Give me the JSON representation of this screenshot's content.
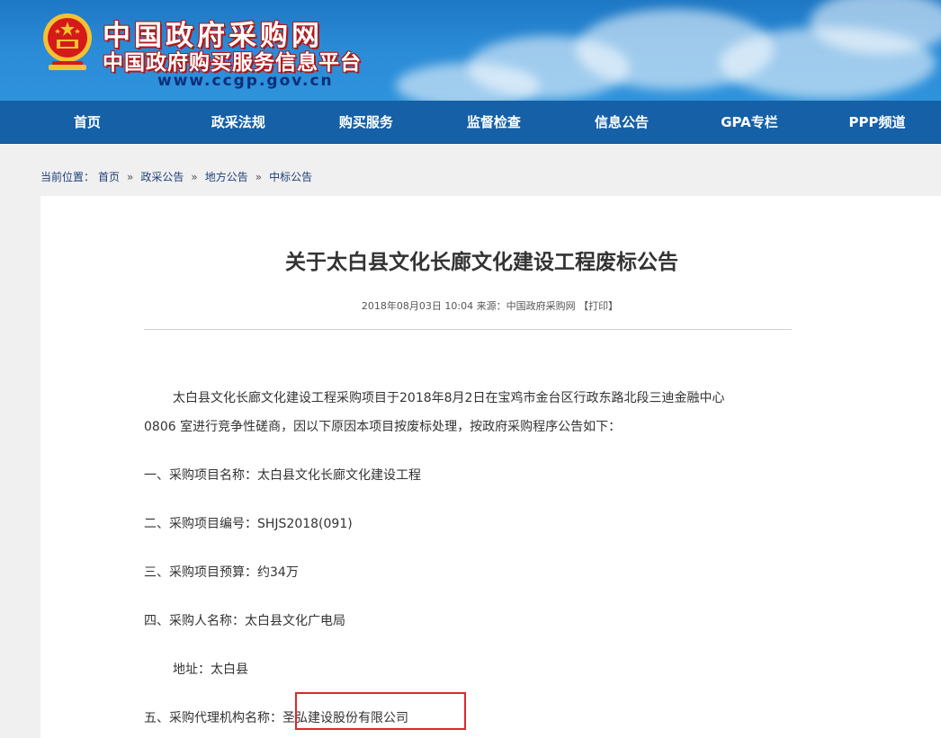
{
  "header": {
    "title": "中国政府采购网",
    "subtitle": "中国政府购买服务信息平台",
    "url": "www.ccgp.gov.cn",
    "emblem_icon": "national-emblem-icon",
    "emblem_color": "#d51a1a",
    "banner_color": "#2a8ad6"
  },
  "nav": {
    "items": [
      "首页",
      "政采法规",
      "购买服务",
      "监督检查",
      "信息公告",
      "GPA专栏",
      "PPP频道"
    ],
    "color": "#1560a6"
  },
  "breadcrumb": {
    "label": "当前位置：",
    "items": [
      "首页",
      "政采公告",
      "地方公告",
      "中标公告"
    ],
    "separator": "»"
  },
  "article": {
    "title": "关于太白县文化长廊文化建设工程废标公告",
    "date": "2018年08月03日",
    "time": "10:04",
    "source": "来源：中国政府采购网",
    "print": "【打印】",
    "intro_line1": "太白县文化长廊文化建设工程采购项目于2018年8月2日在宝鸡市金台区行政东路北段三迪金融中心",
    "intro_line2": "0806 室进行竞争性磋商，因以下原因本项目按废标处理，按政府采购程序公告如下：",
    "item1": "一、采购项目名称：太白县文化长廊文化建设工程",
    "item2": "二、采购项目编号：SHJS2018(091)",
    "item3": "三、采购项目预算：约34万",
    "item4": "四、采购人名称：太白县文化广电局",
    "address": "地址：太白县",
    "item5_label": "五、采购代理机构名称：",
    "item5_value": "圣弘建设股份有限公司",
    "highlight_color": "#e0262b"
  }
}
